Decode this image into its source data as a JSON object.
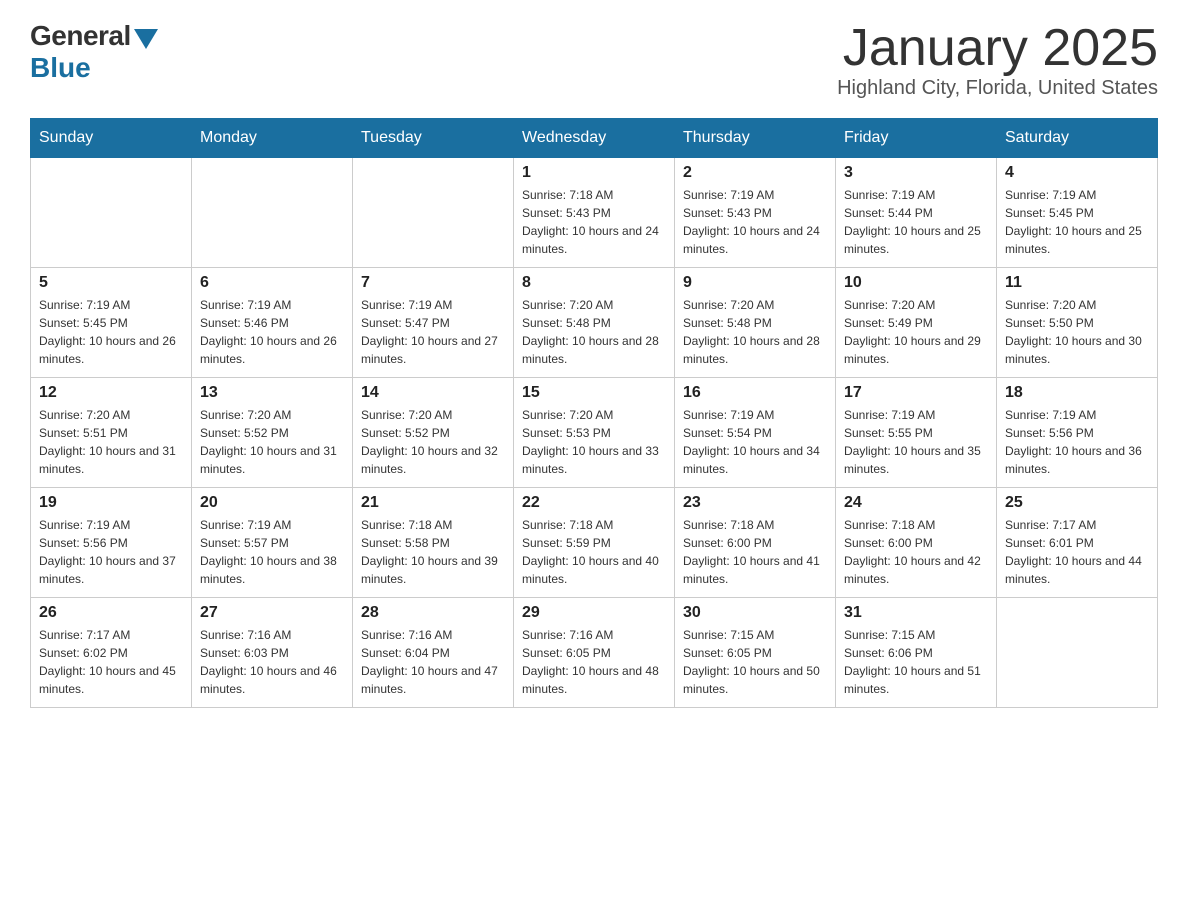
{
  "header": {
    "logo_general": "General",
    "logo_blue": "Blue",
    "month_title": "January 2025",
    "location": "Highland City, Florida, United States"
  },
  "days_of_week": [
    "Sunday",
    "Monday",
    "Tuesday",
    "Wednesday",
    "Thursday",
    "Friday",
    "Saturday"
  ],
  "weeks": [
    [
      {
        "day": "",
        "sunrise": "",
        "sunset": "",
        "daylight": ""
      },
      {
        "day": "",
        "sunrise": "",
        "sunset": "",
        "daylight": ""
      },
      {
        "day": "",
        "sunrise": "",
        "sunset": "",
        "daylight": ""
      },
      {
        "day": "1",
        "sunrise": "Sunrise: 7:18 AM",
        "sunset": "Sunset: 5:43 PM",
        "daylight": "Daylight: 10 hours and 24 minutes."
      },
      {
        "day": "2",
        "sunrise": "Sunrise: 7:19 AM",
        "sunset": "Sunset: 5:43 PM",
        "daylight": "Daylight: 10 hours and 24 minutes."
      },
      {
        "day": "3",
        "sunrise": "Sunrise: 7:19 AM",
        "sunset": "Sunset: 5:44 PM",
        "daylight": "Daylight: 10 hours and 25 minutes."
      },
      {
        "day": "4",
        "sunrise": "Sunrise: 7:19 AM",
        "sunset": "Sunset: 5:45 PM",
        "daylight": "Daylight: 10 hours and 25 minutes."
      }
    ],
    [
      {
        "day": "5",
        "sunrise": "Sunrise: 7:19 AM",
        "sunset": "Sunset: 5:45 PM",
        "daylight": "Daylight: 10 hours and 26 minutes."
      },
      {
        "day": "6",
        "sunrise": "Sunrise: 7:19 AM",
        "sunset": "Sunset: 5:46 PM",
        "daylight": "Daylight: 10 hours and 26 minutes."
      },
      {
        "day": "7",
        "sunrise": "Sunrise: 7:19 AM",
        "sunset": "Sunset: 5:47 PM",
        "daylight": "Daylight: 10 hours and 27 minutes."
      },
      {
        "day": "8",
        "sunrise": "Sunrise: 7:20 AM",
        "sunset": "Sunset: 5:48 PM",
        "daylight": "Daylight: 10 hours and 28 minutes."
      },
      {
        "day": "9",
        "sunrise": "Sunrise: 7:20 AM",
        "sunset": "Sunset: 5:48 PM",
        "daylight": "Daylight: 10 hours and 28 minutes."
      },
      {
        "day": "10",
        "sunrise": "Sunrise: 7:20 AM",
        "sunset": "Sunset: 5:49 PM",
        "daylight": "Daylight: 10 hours and 29 minutes."
      },
      {
        "day": "11",
        "sunrise": "Sunrise: 7:20 AM",
        "sunset": "Sunset: 5:50 PM",
        "daylight": "Daylight: 10 hours and 30 minutes."
      }
    ],
    [
      {
        "day": "12",
        "sunrise": "Sunrise: 7:20 AM",
        "sunset": "Sunset: 5:51 PM",
        "daylight": "Daylight: 10 hours and 31 minutes."
      },
      {
        "day": "13",
        "sunrise": "Sunrise: 7:20 AM",
        "sunset": "Sunset: 5:52 PM",
        "daylight": "Daylight: 10 hours and 31 minutes."
      },
      {
        "day": "14",
        "sunrise": "Sunrise: 7:20 AM",
        "sunset": "Sunset: 5:52 PM",
        "daylight": "Daylight: 10 hours and 32 minutes."
      },
      {
        "day": "15",
        "sunrise": "Sunrise: 7:20 AM",
        "sunset": "Sunset: 5:53 PM",
        "daylight": "Daylight: 10 hours and 33 minutes."
      },
      {
        "day": "16",
        "sunrise": "Sunrise: 7:19 AM",
        "sunset": "Sunset: 5:54 PM",
        "daylight": "Daylight: 10 hours and 34 minutes."
      },
      {
        "day": "17",
        "sunrise": "Sunrise: 7:19 AM",
        "sunset": "Sunset: 5:55 PM",
        "daylight": "Daylight: 10 hours and 35 minutes."
      },
      {
        "day": "18",
        "sunrise": "Sunrise: 7:19 AM",
        "sunset": "Sunset: 5:56 PM",
        "daylight": "Daylight: 10 hours and 36 minutes."
      }
    ],
    [
      {
        "day": "19",
        "sunrise": "Sunrise: 7:19 AM",
        "sunset": "Sunset: 5:56 PM",
        "daylight": "Daylight: 10 hours and 37 minutes."
      },
      {
        "day": "20",
        "sunrise": "Sunrise: 7:19 AM",
        "sunset": "Sunset: 5:57 PM",
        "daylight": "Daylight: 10 hours and 38 minutes."
      },
      {
        "day": "21",
        "sunrise": "Sunrise: 7:18 AM",
        "sunset": "Sunset: 5:58 PM",
        "daylight": "Daylight: 10 hours and 39 minutes."
      },
      {
        "day": "22",
        "sunrise": "Sunrise: 7:18 AM",
        "sunset": "Sunset: 5:59 PM",
        "daylight": "Daylight: 10 hours and 40 minutes."
      },
      {
        "day": "23",
        "sunrise": "Sunrise: 7:18 AM",
        "sunset": "Sunset: 6:00 PM",
        "daylight": "Daylight: 10 hours and 41 minutes."
      },
      {
        "day": "24",
        "sunrise": "Sunrise: 7:18 AM",
        "sunset": "Sunset: 6:00 PM",
        "daylight": "Daylight: 10 hours and 42 minutes."
      },
      {
        "day": "25",
        "sunrise": "Sunrise: 7:17 AM",
        "sunset": "Sunset: 6:01 PM",
        "daylight": "Daylight: 10 hours and 44 minutes."
      }
    ],
    [
      {
        "day": "26",
        "sunrise": "Sunrise: 7:17 AM",
        "sunset": "Sunset: 6:02 PM",
        "daylight": "Daylight: 10 hours and 45 minutes."
      },
      {
        "day": "27",
        "sunrise": "Sunrise: 7:16 AM",
        "sunset": "Sunset: 6:03 PM",
        "daylight": "Daylight: 10 hours and 46 minutes."
      },
      {
        "day": "28",
        "sunrise": "Sunrise: 7:16 AM",
        "sunset": "Sunset: 6:04 PM",
        "daylight": "Daylight: 10 hours and 47 minutes."
      },
      {
        "day": "29",
        "sunrise": "Sunrise: 7:16 AM",
        "sunset": "Sunset: 6:05 PM",
        "daylight": "Daylight: 10 hours and 48 minutes."
      },
      {
        "day": "30",
        "sunrise": "Sunrise: 7:15 AM",
        "sunset": "Sunset: 6:05 PM",
        "daylight": "Daylight: 10 hours and 50 minutes."
      },
      {
        "day": "31",
        "sunrise": "Sunrise: 7:15 AM",
        "sunset": "Sunset: 6:06 PM",
        "daylight": "Daylight: 10 hours and 51 minutes."
      },
      {
        "day": "",
        "sunrise": "",
        "sunset": "",
        "daylight": ""
      }
    ]
  ]
}
